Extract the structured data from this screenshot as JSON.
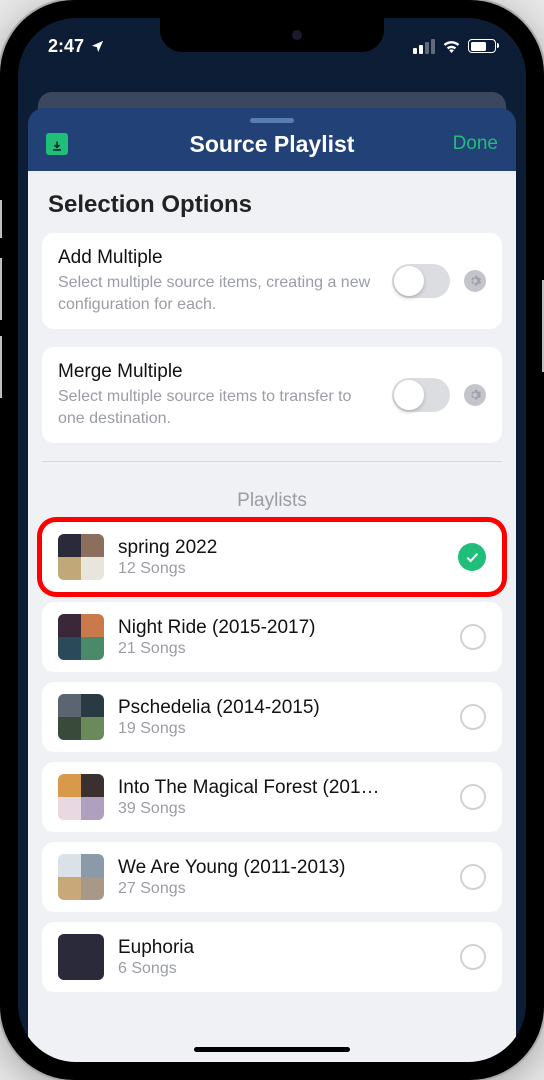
{
  "statusBar": {
    "time": "2:47"
  },
  "header": {
    "title": "Source Playlist",
    "doneLabel": "Done"
  },
  "sectionTitle": "Selection Options",
  "options": {
    "addMultiple": {
      "title": "Add Multiple",
      "desc": "Select multiple source items, creating a new configuration for each."
    },
    "mergeMultiple": {
      "title": "Merge Multiple",
      "desc": "Select multiple source items to transfer to one destination."
    }
  },
  "listHeader": "Playlists",
  "playlists": [
    {
      "name": "spring 2022",
      "count": "12 Songs",
      "selected": true
    },
    {
      "name": "Night Ride (2015-2017)",
      "count": "21 Songs",
      "selected": false
    },
    {
      "name": "Pschedelia (2014-2015)",
      "count": "19 Songs",
      "selected": false
    },
    {
      "name": "Into The Magical Forest (201…",
      "count": "39 Songs",
      "selected": false
    },
    {
      "name": "We Are Young (2011-2013)",
      "count": "27 Songs",
      "selected": false
    },
    {
      "name": "Euphoria",
      "count": "6 Songs",
      "selected": false
    }
  ]
}
